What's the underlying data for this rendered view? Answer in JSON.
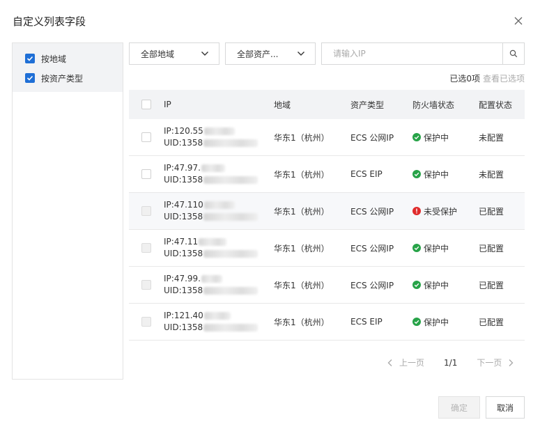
{
  "dialog": {
    "title": "自定义列表字段",
    "close_icon": "close-icon"
  },
  "left_panel": {
    "options": [
      {
        "label": "按地域",
        "checked": true
      },
      {
        "label": "按资产类型",
        "checked": true
      }
    ]
  },
  "filters": {
    "region_select": "全部地域",
    "asset_type_select": "全部资产...",
    "search_placeholder": "请输入IP",
    "search_icon": "search-icon"
  },
  "selection": {
    "count_text": "已选0项",
    "view_selected": "查看已选项"
  },
  "table": {
    "headers": {
      "ip": "IP",
      "region": "地域",
      "asset_type": "资产类型",
      "firewall": "防火墙状态",
      "config": "配置状态"
    },
    "rows": [
      {
        "ip": "IP:120.55",
        "uid": "UID:1358",
        "region": "华东1（杭州）",
        "asset_type": "ECS 公网IP",
        "firewall": "保护中",
        "firewall_state": "ok",
        "config": "未配置",
        "disabled": false
      },
      {
        "ip": "IP:47.97.",
        "uid": "UID:1358",
        "region": "华东1（杭州）",
        "asset_type": "ECS EIP",
        "firewall": "保护中",
        "firewall_state": "ok",
        "config": "未配置",
        "disabled": false
      },
      {
        "ip": "IP:47.110",
        "uid": "UID:1358",
        "region": "华东1（杭州）",
        "asset_type": "ECS 公网IP",
        "firewall": "未受保护",
        "firewall_state": "error",
        "config": "已配置",
        "disabled": true
      },
      {
        "ip": "IP:47.11",
        "uid": "UID:1358",
        "region": "华东1（杭州）",
        "asset_type": "ECS 公网IP",
        "firewall": "保护中",
        "firewall_state": "ok",
        "config": "已配置",
        "disabled": true
      },
      {
        "ip": "IP:47.99.",
        "uid": "UID:1358",
        "region": "华东1（杭州）",
        "asset_type": "ECS 公网IP",
        "firewall": "保护中",
        "firewall_state": "ok",
        "config": "已配置",
        "disabled": true
      },
      {
        "ip": "IP:121.40",
        "uid": "UID:1358",
        "region": "华东1（杭州）",
        "asset_type": "ECS EIP",
        "firewall": "保护中",
        "firewall_state": "ok",
        "config": "已配置",
        "disabled": true
      }
    ]
  },
  "pagination": {
    "prev": "上一页",
    "page": "1/1",
    "next": "下一页"
  },
  "footer": {
    "confirm": "确定",
    "cancel": "取消"
  },
  "colors": {
    "accent": "#1f6fd6",
    "ok": "#27a348",
    "error": "#e02b2b"
  }
}
